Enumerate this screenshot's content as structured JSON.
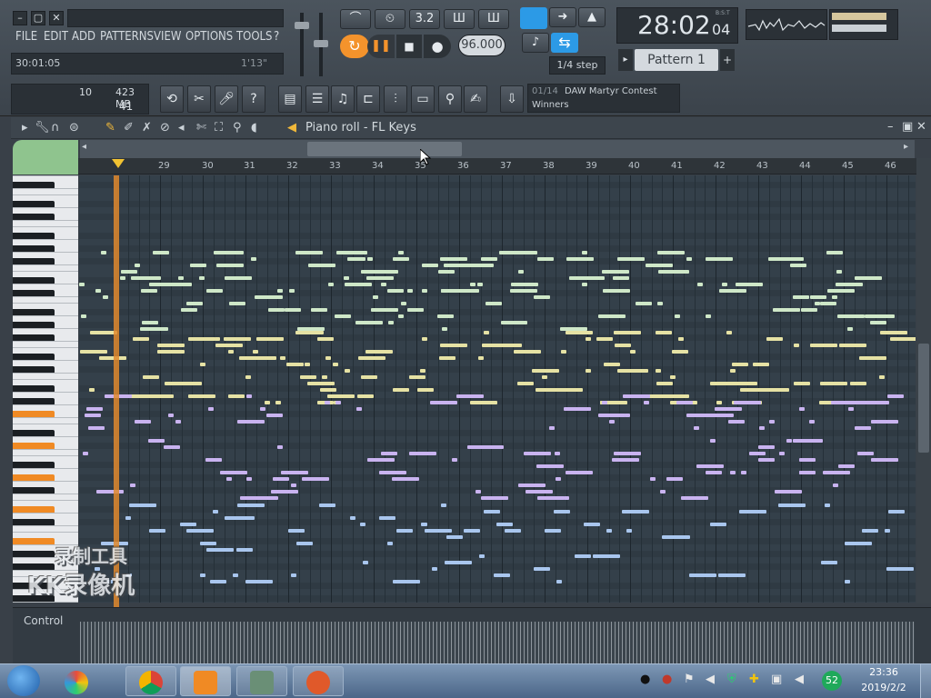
{
  "menu": [
    "FILE",
    "EDIT",
    "ADD",
    "PATTERNS",
    "VIEW",
    "OPTIONS",
    "TOOLS",
    "?"
  ],
  "window_controls": {
    "minimize": "–",
    "restore": "▢",
    "close": "✕"
  },
  "hint_bar": {
    "left": "30:01:05",
    "right": "1'13\""
  },
  "tempo": "96.000",
  "clock": {
    "main": "28:02",
    "sub": "04",
    "label": "B:S:T"
  },
  "snap": "1/4 step",
  "pattern": "Pattern 1",
  "news": {
    "index": "01/14",
    "line1": "DAW Martyr Contest",
    "line2": "Winners"
  },
  "status": {
    "num": "10",
    "mem": "423 MB",
    "cpu": "41"
  },
  "piano_roll": {
    "title": "Piano roll - FL Keys"
  },
  "ruler": [
    "29",
    "30",
    "31",
    "32",
    "33",
    "34",
    "35",
    "36",
    "37",
    "38",
    "39",
    "40",
    "41",
    "42",
    "43",
    "44",
    "45",
    "46"
  ],
  "control": {
    "label": "Control"
  },
  "watermark": {
    "line1": "录制工具",
    "line2": "KK录像机"
  },
  "taskbar": {
    "time": "23:36",
    "date": "2019/2/2",
    "badge": "52"
  },
  "colors": {
    "note_green": "#cfe8c8",
    "note_yellow": "#e6e2a4",
    "note_purple": "#c9b3f0",
    "note_blue": "#a9c6ee",
    "accent_orange": "#f08a24"
  }
}
